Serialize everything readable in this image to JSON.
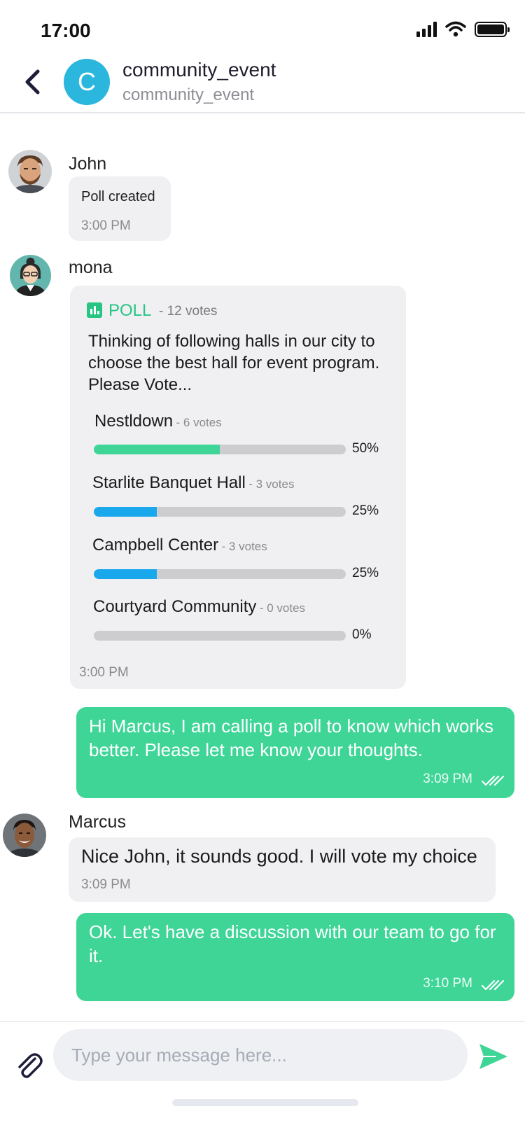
{
  "status_bar": {
    "time": "17:00"
  },
  "header": {
    "avatar_letter": "C",
    "title": "community_event",
    "subtitle": "community_event"
  },
  "messages": {
    "m1": {
      "sender": "John",
      "text": "Poll created",
      "time": "3:00 PM"
    },
    "poll": {
      "sender": "mona",
      "badge": "POLL",
      "total_votes": "- 12 votes",
      "question": "Thinking of following halls in our city to choose the best hall for event program. Please Vote...",
      "time": "3:00 PM",
      "options": [
        {
          "label": "Nestldown",
          "votes": "- 6 votes",
          "percent": "50%",
          "fraction": 0.5,
          "color": "#3ed597"
        },
        {
          "label": "Starlite Banquet Hall",
          "votes": "- 3 votes",
          "percent": "25%",
          "fraction": 0.25,
          "color": "#1aa8ec"
        },
        {
          "label": "Campbell Center",
          "votes": "- 3 votes",
          "percent": "25%",
          "fraction": 0.25,
          "color": "#1aa8ec"
        },
        {
          "label": "Courtyard Community",
          "votes": "- 0 votes",
          "percent": "0%",
          "fraction": 0,
          "color": "#1aa8ec"
        }
      ]
    },
    "m2": {
      "text": "Hi Marcus, I am calling a poll to know which works better. Please let me know your thoughts.",
      "time": "3:09 PM"
    },
    "m3": {
      "sender": "Marcus",
      "text": "Nice John, it sounds good. I will vote my choice",
      "time": "3:09 PM"
    },
    "m4": {
      "text": "Ok. Let's have a discussion with our team to go for it.",
      "time": "3:10 PM"
    }
  },
  "composer": {
    "placeholder": "Type your message here..."
  },
  "colors": {
    "accent": "#3ed597",
    "blue": "#1aa8ec",
    "avatar": "#2bb6dd"
  }
}
